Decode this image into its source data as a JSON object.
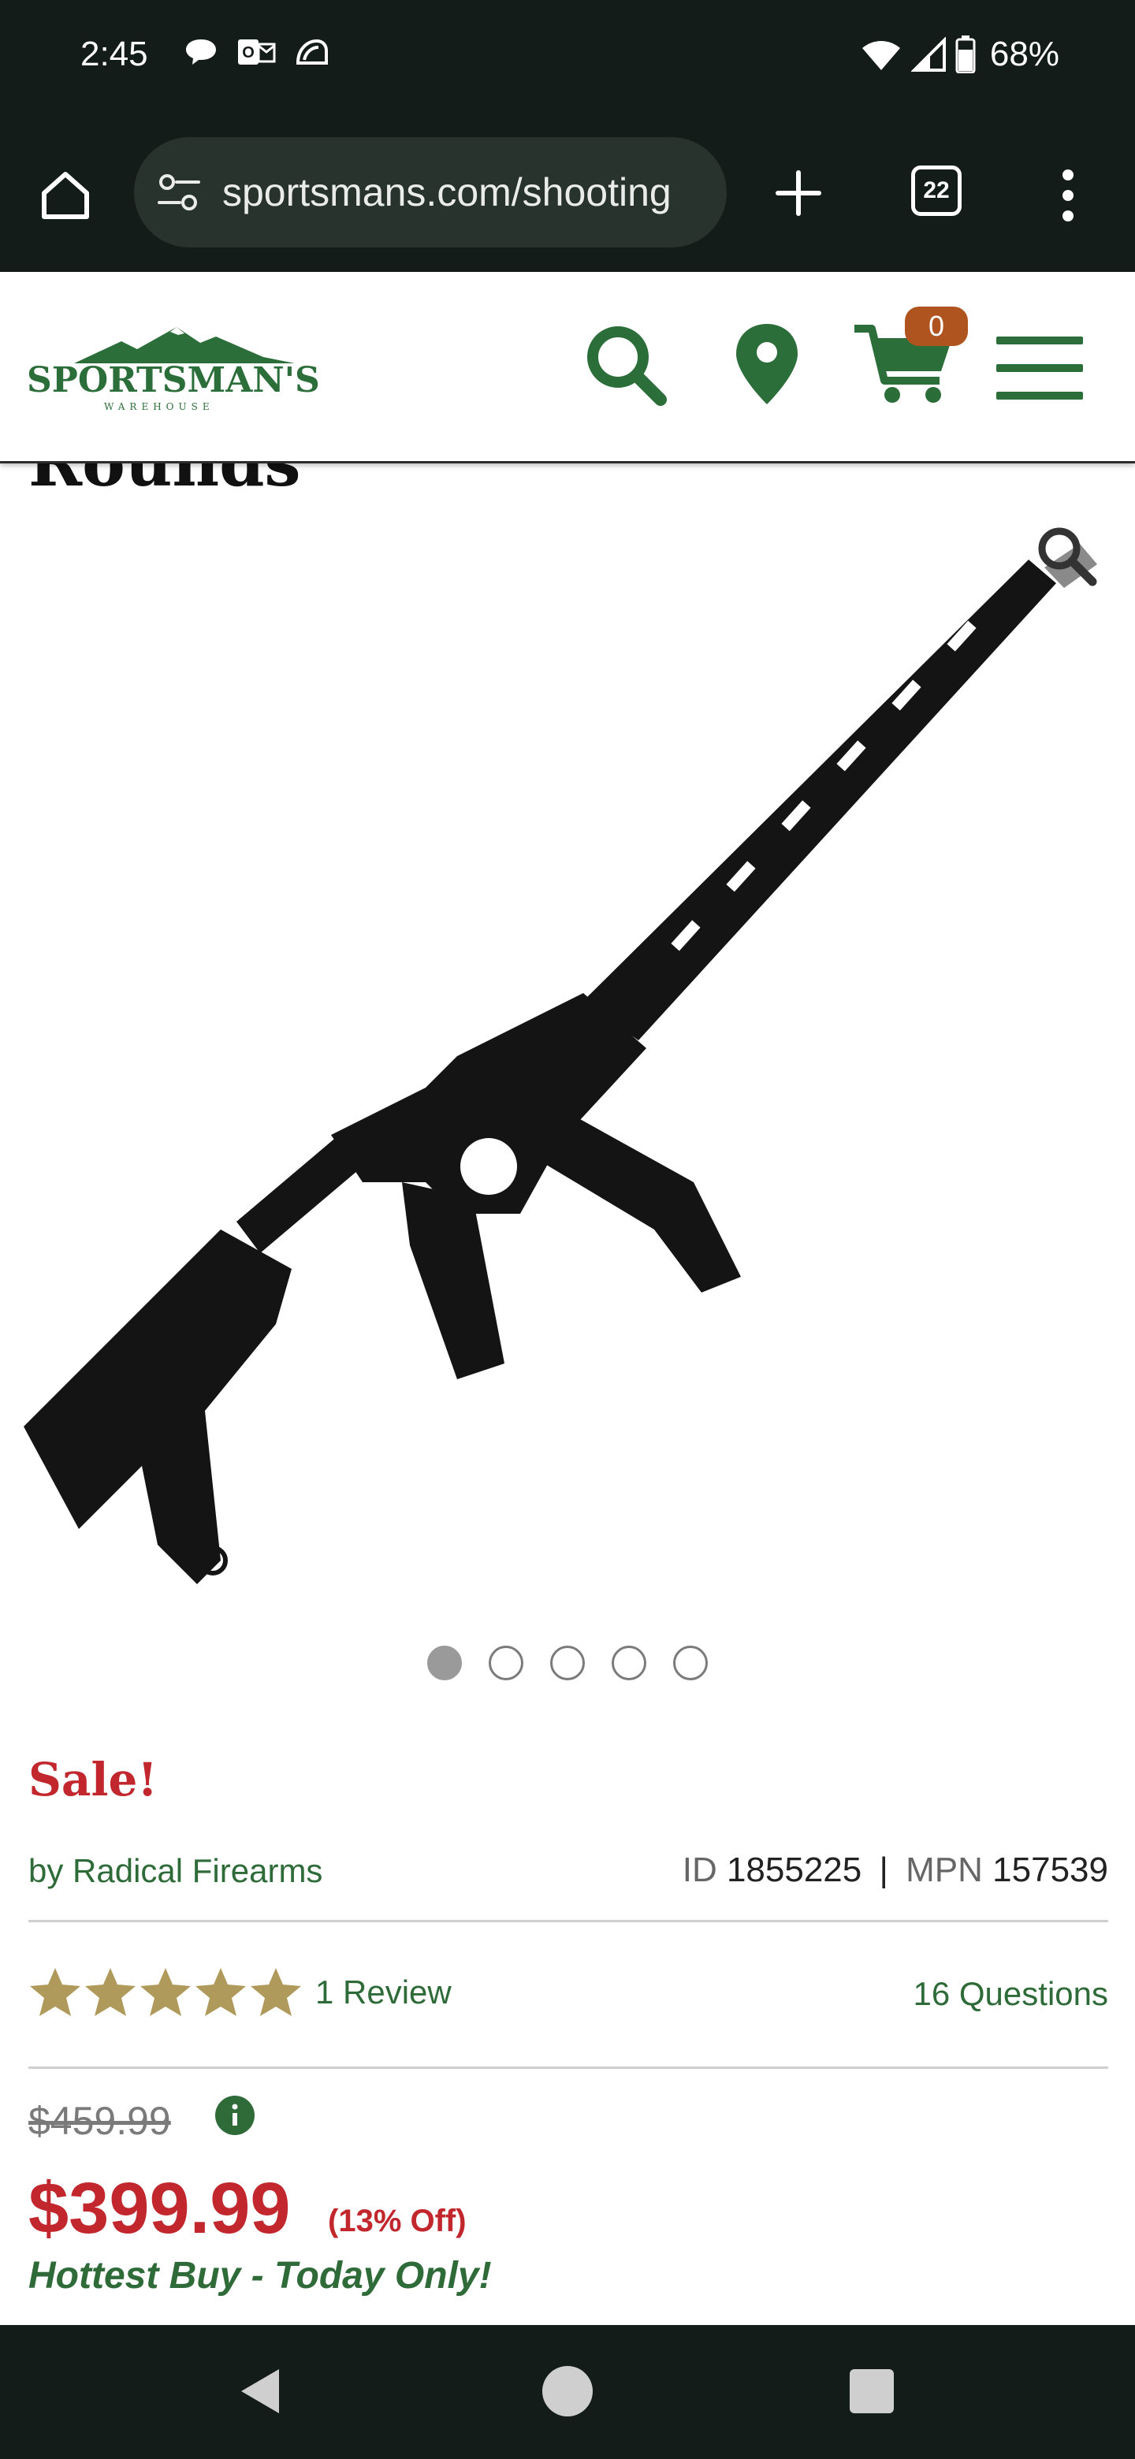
{
  "status_bar": {
    "time": "2:45",
    "battery": "68%",
    "icons_left": [
      "chat-bubble-icon",
      "outlook-icon",
      "taco-bell-icon"
    ],
    "icons_right": [
      "wifi-icon",
      "cell-signal-icon",
      "battery-icon"
    ]
  },
  "browser": {
    "url": "sportsmans.com/shooting",
    "tab_count": "22",
    "icons": [
      "home-icon",
      "tune-icon",
      "plus-icon",
      "tab-switcher-icon",
      "more-vert-icon"
    ]
  },
  "header": {
    "logo_text": "SPORTSMAN'S",
    "logo_subtext": "WAREHOUSE",
    "cart_count": "0",
    "brand_color": "#2c6e3a",
    "cart_badge_color": "#b0541f",
    "icons": [
      "search-icon",
      "location-pin-icon",
      "cart-icon",
      "hamburger-menu-icon"
    ]
  },
  "product": {
    "title_fragment": "Rounds",
    "image_alt_icon": "rifle-image",
    "carousel": {
      "count": 5,
      "active_index": 0
    },
    "sale_label": "Sale!",
    "brand_line": "by Radical Firearms",
    "id_label": "ID",
    "id_value": "1855225",
    "separator": "|",
    "mpn_label": "MPN",
    "mpn_value": "157539",
    "rating_stars": 5,
    "reviews_label": "1 Review",
    "questions_label": "16 Questions",
    "original_price": "$459.99",
    "sale_price": "$399.99",
    "percent_off": "(13% Off)",
    "promo_text": "Hottest Buy - Today Only!",
    "sale_color": "#c1272d",
    "star_color": "#b09a5b"
  },
  "nav_bar": {
    "icons": [
      "back-icon",
      "home-circle-icon",
      "recents-icon"
    ]
  }
}
